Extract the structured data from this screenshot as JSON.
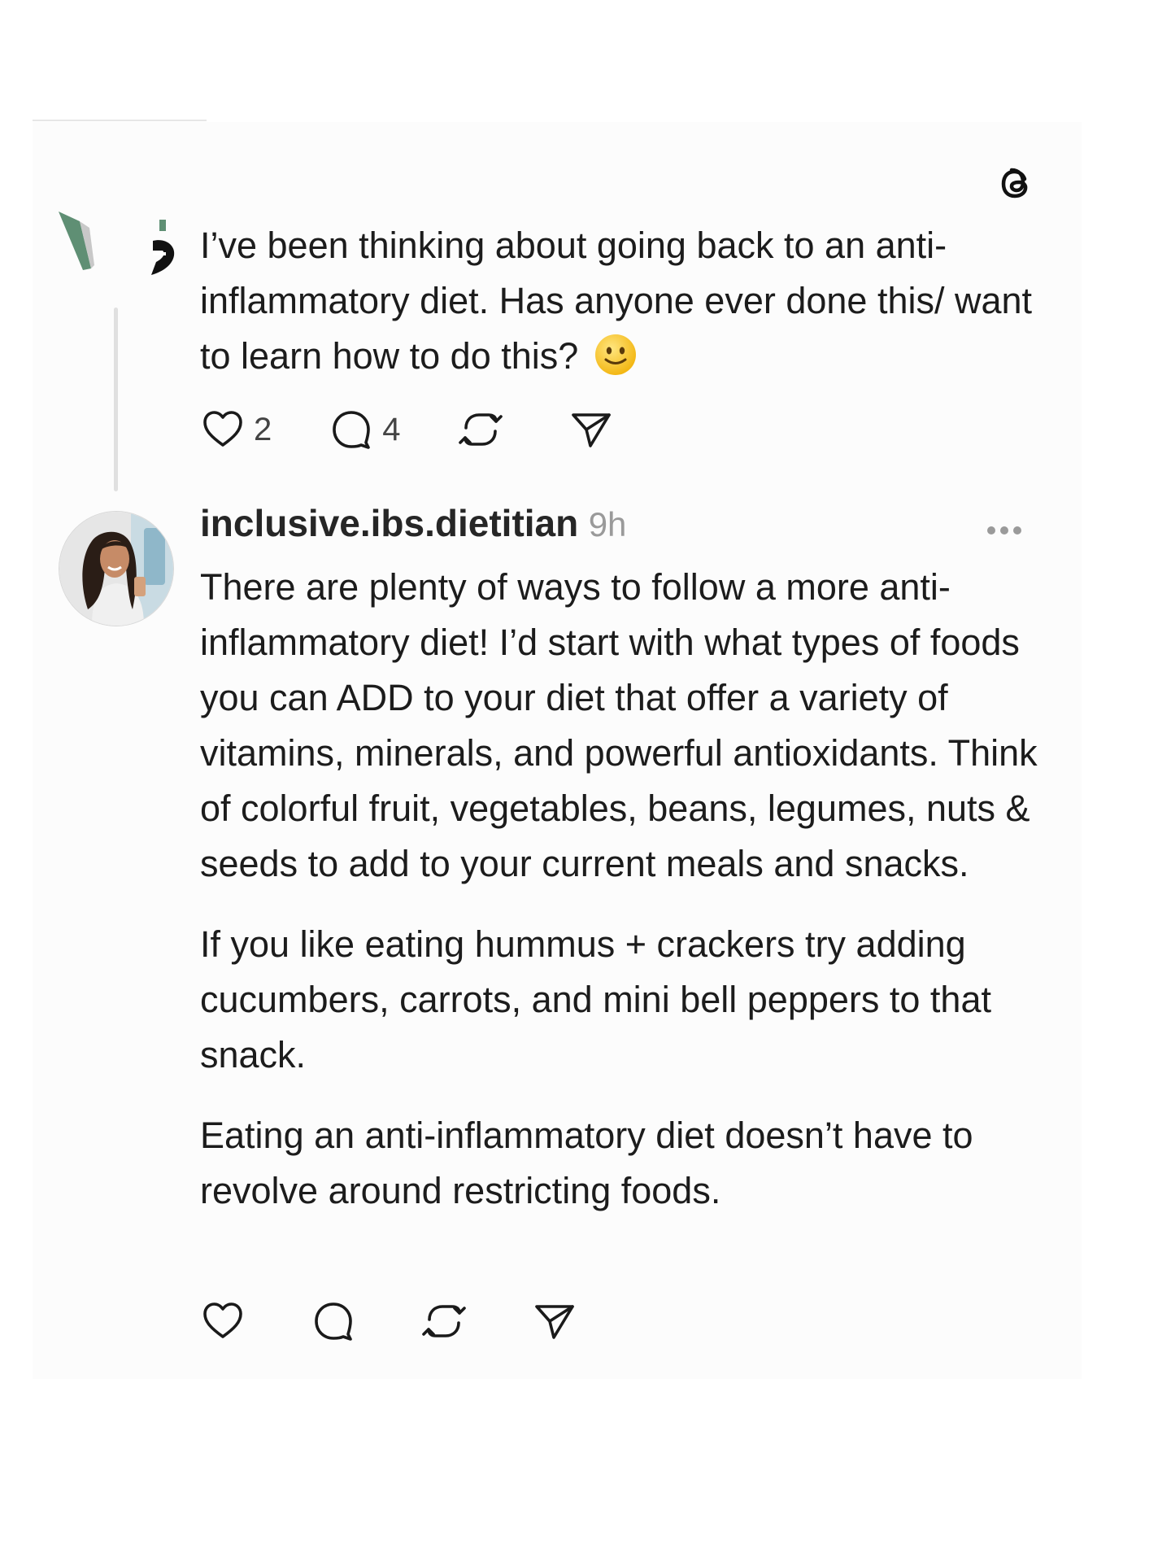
{
  "original_post": {
    "text": "I’ve been thinking about going back to an anti-inflammatory diet. Has anyone ever done this/ want to learn how to do this?",
    "emoji": "slightly-smiling-face",
    "likes": "2",
    "replies": "4"
  },
  "reply": {
    "username": "inclusive.ibs.dietitian",
    "timestamp": "9h",
    "paragraphs": [
      "There are plenty of ways to follow a more anti-inflammatory diet! I’d start with what types of foods you can ADD to your diet that offer a variety of vitamins, minerals, and powerful antioxidants. Think of colorful fruit, vegetables, beans, legumes, nuts & seeds to add to your current meals and snacks.",
      "If you like eating hummus + crackers try adding cucumbers, carrots, and mini bell peppers to that snack.",
      "Eating an anti-inflammatory diet doesn’t have to revolve around restricting foods."
    ]
  },
  "icons": {
    "logo": "threads-logo-icon",
    "like": "heart-icon",
    "reply": "comment-icon",
    "repost": "repost-icon",
    "share": "send-icon",
    "more": "more-dots-icon"
  },
  "colors": {
    "text": "#1c1c1c",
    "muted": "#9a9a9a",
    "thread_line": "#e0e0e0"
  }
}
